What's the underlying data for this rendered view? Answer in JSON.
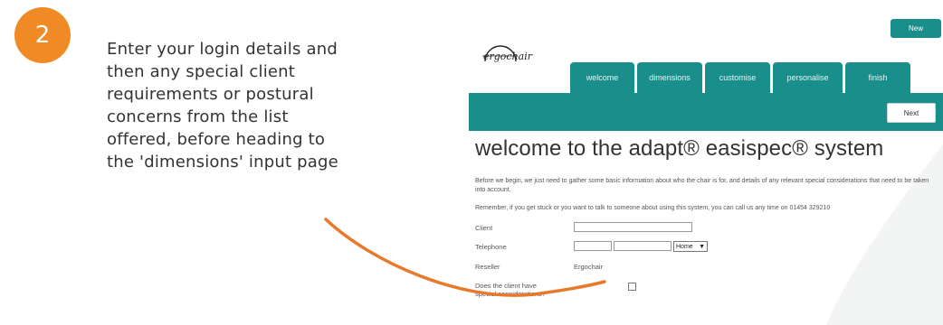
{
  "step": {
    "number": "2",
    "color": "#f08a24"
  },
  "instructions": [
    "Enter your login details and",
    "then any special client",
    "requirements or postural",
    "concerns from the list",
    "offered, before heading to",
    "the 'dimensions' input page"
  ],
  "app": {
    "logo_text": "ergochair",
    "new_button": "New",
    "tabs": [
      "welcome",
      "dimensions",
      "customise",
      "personalise",
      "finish"
    ],
    "next_button": "Next",
    "heading": "welcome to the adapt® easispec® system",
    "intro": "Before we begin, we just need to gather some basic information about who the chair is for, and details of any relevant special considerations that need to be taken into account.",
    "remember": "Remember, if you get stuck or you want to talk to someone about using this system, you can call us any time on 01454 329210",
    "form": {
      "client_label": "Client",
      "client_value": "",
      "telephone_label": "Telephone",
      "telephone_type": "Home",
      "reseller_label": "Reseller",
      "reseller_value": "Ergochair",
      "special_label": "Does the client have special considerations?",
      "special_checked": false
    },
    "accent_color": "#1a8e8a"
  }
}
